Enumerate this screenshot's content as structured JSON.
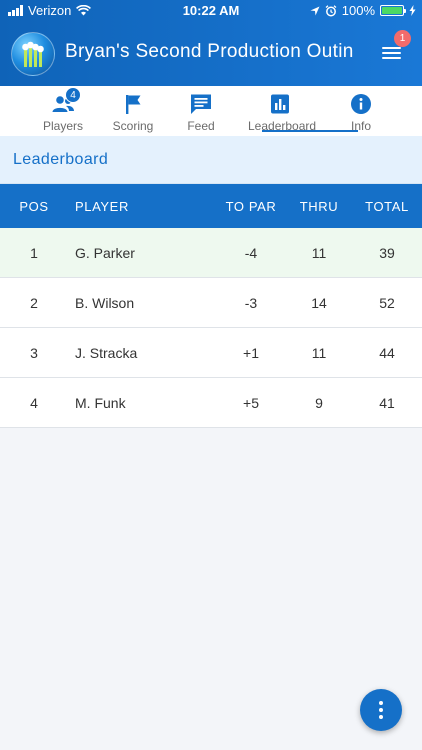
{
  "status_bar": {
    "carrier": "Verizon",
    "time": "10:22 AM",
    "battery": "100%"
  },
  "header": {
    "title": "Bryan's Second Production Outin",
    "menu_badge": "1"
  },
  "tabs": [
    {
      "label": "Players",
      "icon": "players-icon",
      "badge": "4",
      "active": false
    },
    {
      "label": "Scoring",
      "icon": "flag-icon",
      "active": false
    },
    {
      "label": "Feed",
      "icon": "feed-icon",
      "active": false
    },
    {
      "label": "Leaderboard",
      "icon": "leaderboard-icon",
      "active": true
    },
    {
      "label": "Info",
      "icon": "info-icon",
      "active": false
    }
  ],
  "section_title": "Leaderboard",
  "table": {
    "headers": {
      "pos": "POS",
      "player": "PLAYER",
      "to_par": "TO PAR",
      "thru": "THRU",
      "total": "TOTAL"
    },
    "rows": [
      {
        "pos": "1",
        "player": "G. Parker",
        "to_par": "-4",
        "thru": "11",
        "total": "39"
      },
      {
        "pos": "2",
        "player": "B. Wilson",
        "to_par": "-3",
        "thru": "14",
        "total": "52"
      },
      {
        "pos": "3",
        "player": "J. Stracka",
        "to_par": "+1",
        "thru": "11",
        "total": "44"
      },
      {
        "pos": "4",
        "player": "M. Funk",
        "to_par": "+5",
        "thru": "9",
        "total": "41"
      }
    ]
  },
  "colors": {
    "primary": "#1570c8",
    "header_bg": "#1a78d6",
    "leader_row_bg": "#eef9ef",
    "section_bg": "#e4f1fd",
    "badge_red": "#f26b6b"
  }
}
